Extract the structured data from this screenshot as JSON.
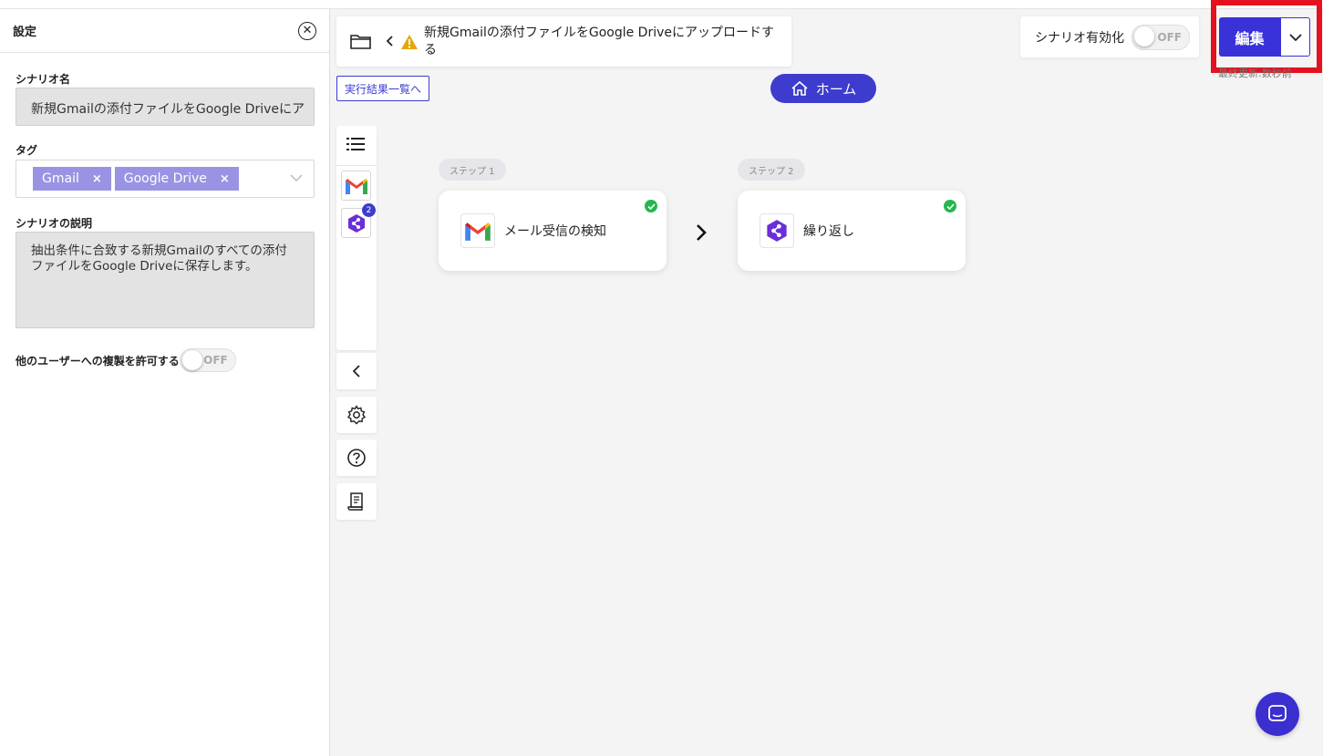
{
  "settings_panel": {
    "title": "設定",
    "scenario_name_label": "シナリオ名",
    "scenario_name_value": "新規Gmailの添付ファイルをGoogle Driveにア",
    "tags_label": "タグ",
    "tags": [
      {
        "label": "Gmail"
      },
      {
        "label": "Google Drive"
      }
    ],
    "tag_remove_glyph": "×",
    "description_label": "シナリオの説明",
    "description_value": "抽出条件に合致する新規Gmailのすべての添付ファイルをGoogle Driveに保存します。",
    "allow_duplicate_label": "他のユーザーへの複製を許可する",
    "allow_duplicate_toggle": "OFF"
  },
  "header": {
    "scenario_title": "新規Gmailの添付ファイルをGoogle Driveにアップロードする",
    "results_link": "実行結果一覧へ",
    "home_button": "ホーム",
    "activation_label": "シナリオ有効化",
    "activation_toggle": "OFF",
    "edit_button": "編集",
    "last_updated": "最終更新:数秒前"
  },
  "rail": {
    "app_badge_count": "2"
  },
  "steps": [
    {
      "label": "ステップ 1",
      "name": "メール受信の検知",
      "icon": "gmail-icon"
    },
    {
      "label": "ステップ 2",
      "name": "繰り返し",
      "icon": "loop-icon"
    }
  ],
  "colors": {
    "accent": "#3d3ccf",
    "highlight_border": "#e3121e",
    "tag_bg": "#9a93e3",
    "success": "#22b84a"
  }
}
